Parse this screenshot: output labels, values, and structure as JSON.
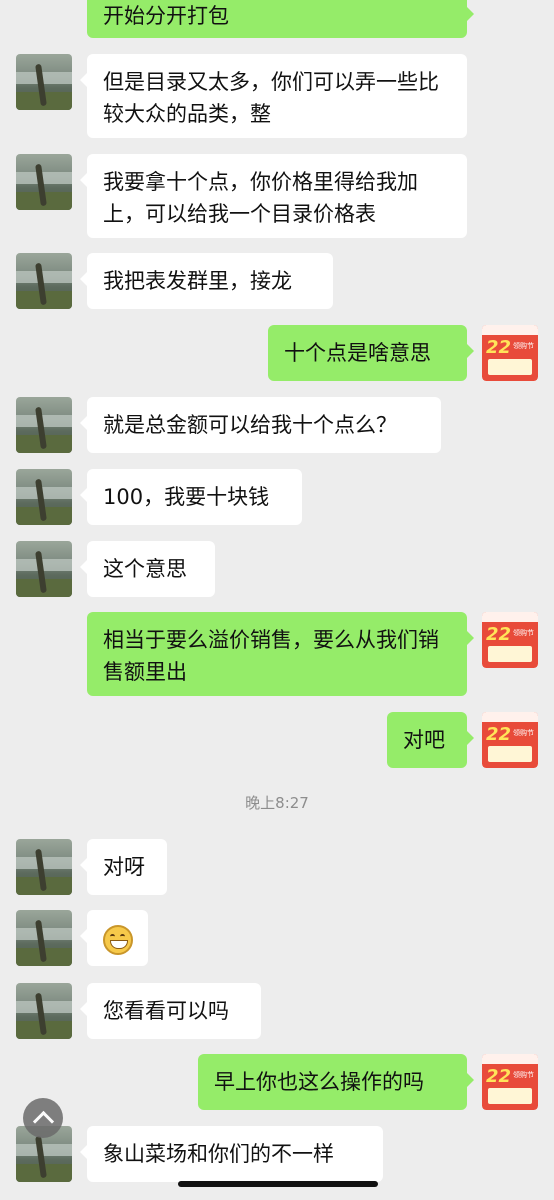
{
  "messages": [
    {
      "side": "out",
      "text": "开始分开打包"
    },
    {
      "side": "in",
      "text": "但是目录又太多，你们可以弄一些比较大众的品类，整"
    },
    {
      "side": "in",
      "text": "我要拿十个点，你价格里得给我加上，可以给我一个目录价格表"
    },
    {
      "side": "in",
      "text": "我把表发群里，接龙"
    },
    {
      "side": "out",
      "text": "十个点是啥意思"
    },
    {
      "side": "in",
      "text": "就是总金额可以给我十个点么？"
    },
    {
      "side": "in",
      "text": "100，我要十块钱"
    },
    {
      "side": "in",
      "text": "这个意思"
    },
    {
      "side": "out",
      "text": "相当于要么溢价销售，要么从我们销售额里出"
    },
    {
      "side": "out",
      "text": "对吧"
    },
    {
      "side": "in",
      "text": "对呀"
    },
    {
      "side": "in",
      "text": ""
    },
    {
      "side": "in",
      "text": "您看看可以吗"
    },
    {
      "side": "out",
      "text": "早上你也这么操作的吗"
    },
    {
      "side": "in",
      "text": "象山菜场和你们的不一样"
    }
  ],
  "timestamp": "晚上8:27",
  "promo_avatar": {
    "big": "22",
    "tag": "领购节"
  },
  "icons": {
    "scroll_top": "chevron-up-icon",
    "emoji": "grinning-face-icon"
  }
}
